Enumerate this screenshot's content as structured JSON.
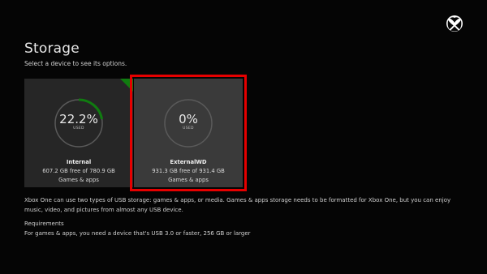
{
  "header": {
    "title": "Storage",
    "subtitle": "Select a device to see its options."
  },
  "devices": [
    {
      "name": "Internal",
      "used_percent_label": "22.2%",
      "used_fraction": 0.222,
      "used_label": "USED",
      "free_text": "607.2 GB free of 780.9 GB",
      "type": "Games & apps",
      "selected": false
    },
    {
      "name": "ExternalWD",
      "used_percent_label": "0%",
      "used_fraction": 0,
      "used_label": "USED",
      "free_text": "931.3 GB free of 931.4 GB",
      "type": "Games & apps",
      "selected": true
    }
  ],
  "info": {
    "usb_text": "Xbox One can use two types of USB storage: games & apps, or media. Games & apps storage needs to be formatted for Xbox One, but you can enjoy music, video, and pictures from almost any USB device.",
    "requirements_heading": "Requirements",
    "requirements_text": "For games & apps, you need a device that's USB 3.0 or faster, 256 GB or larger"
  },
  "colors": {
    "accent": "#107c10",
    "selection": "#e60000",
    "ring_track": "#5a5a5a"
  },
  "icons": {
    "logo": "xbox-logo-icon"
  }
}
